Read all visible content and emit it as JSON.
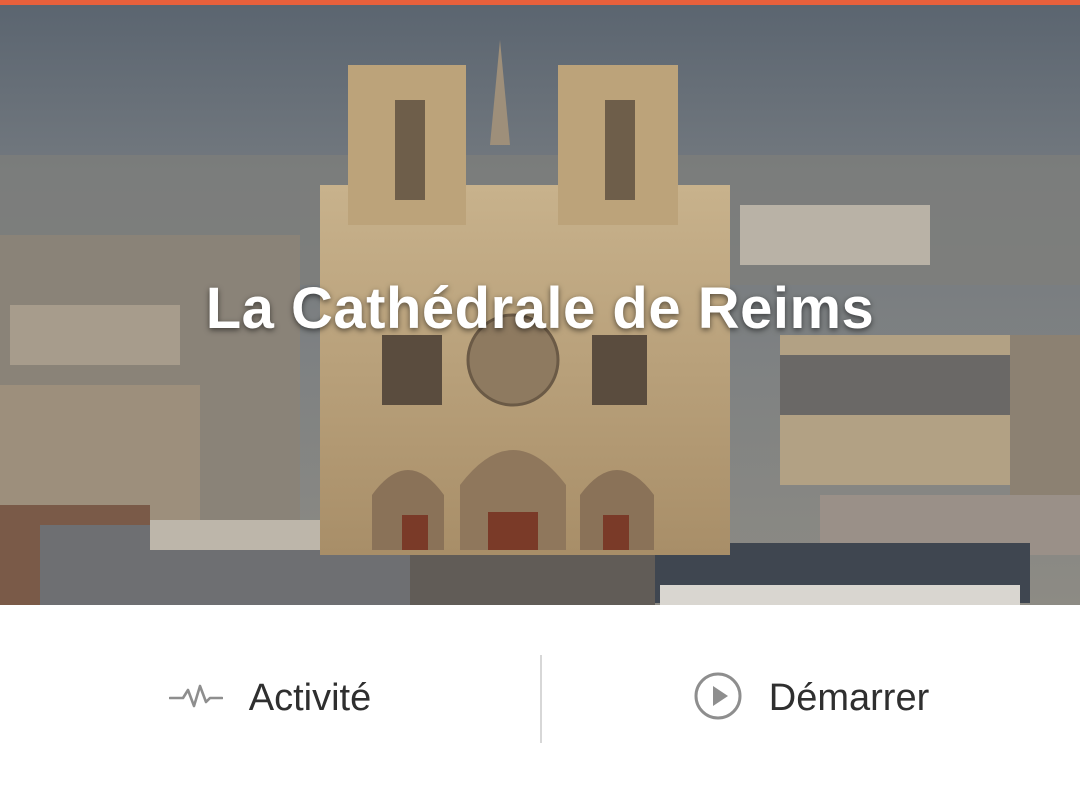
{
  "colors": {
    "accent": "#e8603c",
    "icon_gray": "#8e8e8e",
    "label_text": "#2f2f2f"
  },
  "hero": {
    "title": "La Cathédrale de Reims",
    "image": "reims-cathedral-photo"
  },
  "actions": {
    "activity": {
      "label": "Activité",
      "icon": "activity-pulse-icon"
    },
    "start": {
      "label": "Démarrer",
      "icon": "play-circle-icon"
    }
  }
}
